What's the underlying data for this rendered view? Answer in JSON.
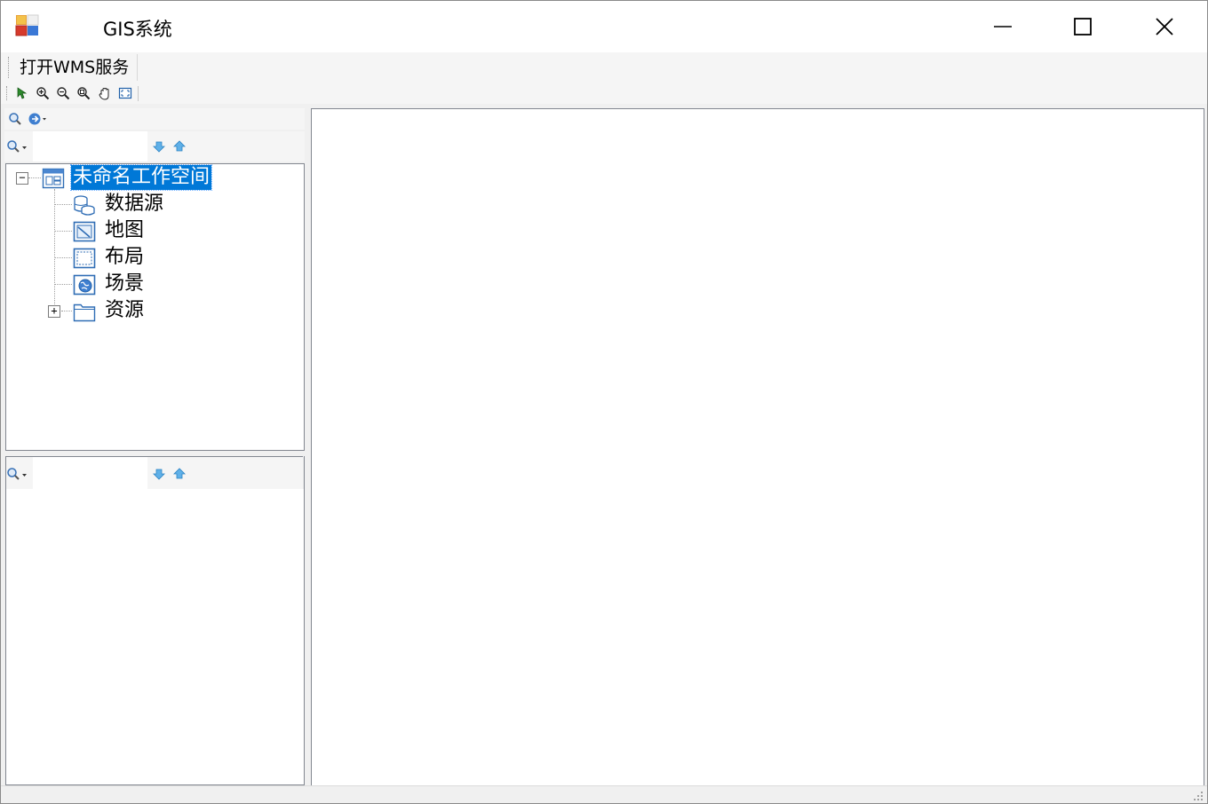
{
  "window": {
    "title": "GIS系统",
    "controls": {
      "minimize": "minimize",
      "maximize": "maximize",
      "close": "close"
    }
  },
  "menu": {
    "items": [
      {
        "label": "打开WMS服务"
      }
    ]
  },
  "toolbar": {
    "buttons": [
      {
        "name": "select-arrow-icon"
      },
      {
        "name": "zoom-in-icon"
      },
      {
        "name": "zoom-out-icon"
      },
      {
        "name": "zoom-free-icon"
      },
      {
        "name": "pan-hand-icon"
      },
      {
        "name": "full-extent-icon"
      }
    ]
  },
  "workspace_panel": {
    "tools": [
      "search-icon",
      "locate-arrow-icon"
    ],
    "filter_tools": [
      "search-dropdown-icon",
      "move-down-icon",
      "move-up-icon"
    ],
    "tree": {
      "root": {
        "label": "未命名工作空间",
        "expanded": true,
        "selected": true
      },
      "children": [
        {
          "label": "数据源",
          "icon": "datasource-icon"
        },
        {
          "label": "地图",
          "icon": "map-icon"
        },
        {
          "label": "布局",
          "icon": "layout-icon"
        },
        {
          "label": "场景",
          "icon": "scene-icon"
        },
        {
          "label": "资源",
          "icon": "folder-icon",
          "expandable": true
        }
      ]
    }
  },
  "layer_panel": {
    "filter_tools": [
      "search-dropdown-icon",
      "move-down-icon",
      "move-up-icon"
    ]
  },
  "colors": {
    "selection": "#0078d7",
    "chrome": "#f0f0f0",
    "border": "#828790"
  }
}
